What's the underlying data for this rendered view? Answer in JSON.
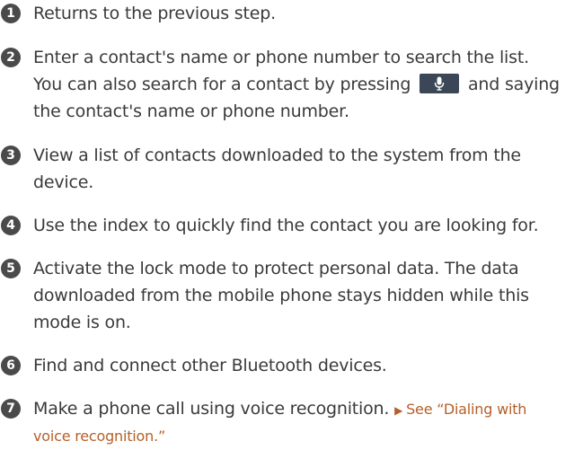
{
  "items": [
    {
      "number": "1",
      "lines": [
        "Returns to the previous step."
      ]
    },
    {
      "number": "2",
      "lines": [
        "Enter a contact's name or phone number to search the list.",
        "the contact's name or phone number."
      ],
      "inline_before": "You can also search for a contact by pressing",
      "inline_after": "and saying",
      "inline_icon": "microphone-icon"
    },
    {
      "number": "3",
      "lines": [
        "View a list of contacts downloaded to the system from the",
        "device."
      ]
    },
    {
      "number": "4",
      "lines": [
        "Use the index to quickly find the contact you are looking for."
      ]
    },
    {
      "number": "5",
      "lines": [
        "Activate the lock mode to protect personal data. The data",
        "downloaded from the mobile phone stays hidden while this",
        "mode is on."
      ]
    },
    {
      "number": "6",
      "lines": [
        "Find and connect other Bluetooth devices."
      ]
    },
    {
      "number": "7",
      "lines": [
        "Make a phone call using voice recognition."
      ],
      "reference_arrow": "▶",
      "reference_part1": "See “Dialing with",
      "reference_part2": "voice recognition.”"
    }
  ],
  "colors": {
    "text": "#3a3a3a",
    "number_badge": "#4a4a4a",
    "mic_button": "#3b4756",
    "reference": "#b5602a"
  }
}
